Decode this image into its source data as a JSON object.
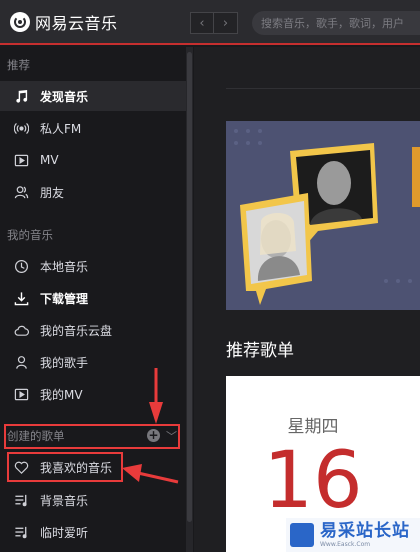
{
  "app": {
    "name": "网易云音乐"
  },
  "topbar": {
    "back_glyph": "‹",
    "forward_glyph": "›",
    "search_placeholder": "搜索音乐，歌手，歌词，用户"
  },
  "sidebar": {
    "section_recommend": "推荐",
    "recommend_items": [
      {
        "label": "发现音乐",
        "icon": "music-note-icon",
        "active": true
      },
      {
        "label": "私人FM",
        "icon": "radio-icon"
      },
      {
        "label": "MV",
        "icon": "video-icon"
      },
      {
        "label": "朋友",
        "icon": "friends-icon"
      }
    ],
    "section_my_music": "我的音乐",
    "my_music_items": [
      {
        "label": "本地音乐",
        "icon": "clock-icon"
      },
      {
        "label": "下载管理",
        "icon": "download-icon",
        "bold": true
      },
      {
        "label": "我的音乐云盘",
        "icon": "cloud-icon"
      },
      {
        "label": "我的歌手",
        "icon": "singer-icon"
      },
      {
        "label": "我的MV",
        "icon": "video-icon"
      }
    ],
    "section_created_playlists": "创建的歌单",
    "add_glyph": "+",
    "collapse_glyph": "﹀",
    "playlist_items": [
      {
        "label": "我喜欢的音乐",
        "icon": "heart-icon"
      },
      {
        "label": "背景音乐",
        "icon": "playlist-icon"
      },
      {
        "label": "临时爱听",
        "icon": "playlist-icon"
      }
    ]
  },
  "main": {
    "recommended_playlists_title": "推荐歌单",
    "calendar_weekday": "星期四",
    "calendar_day": "16"
  },
  "watermark": {
    "title": "易采站长站",
    "url": "Www.Easck.Com"
  },
  "colors": {
    "accent_red": "#c62f2f",
    "annotation_red": "#e83b3b",
    "sidebar_bg": "#19191c",
    "banner_bg": "#4d5272"
  }
}
